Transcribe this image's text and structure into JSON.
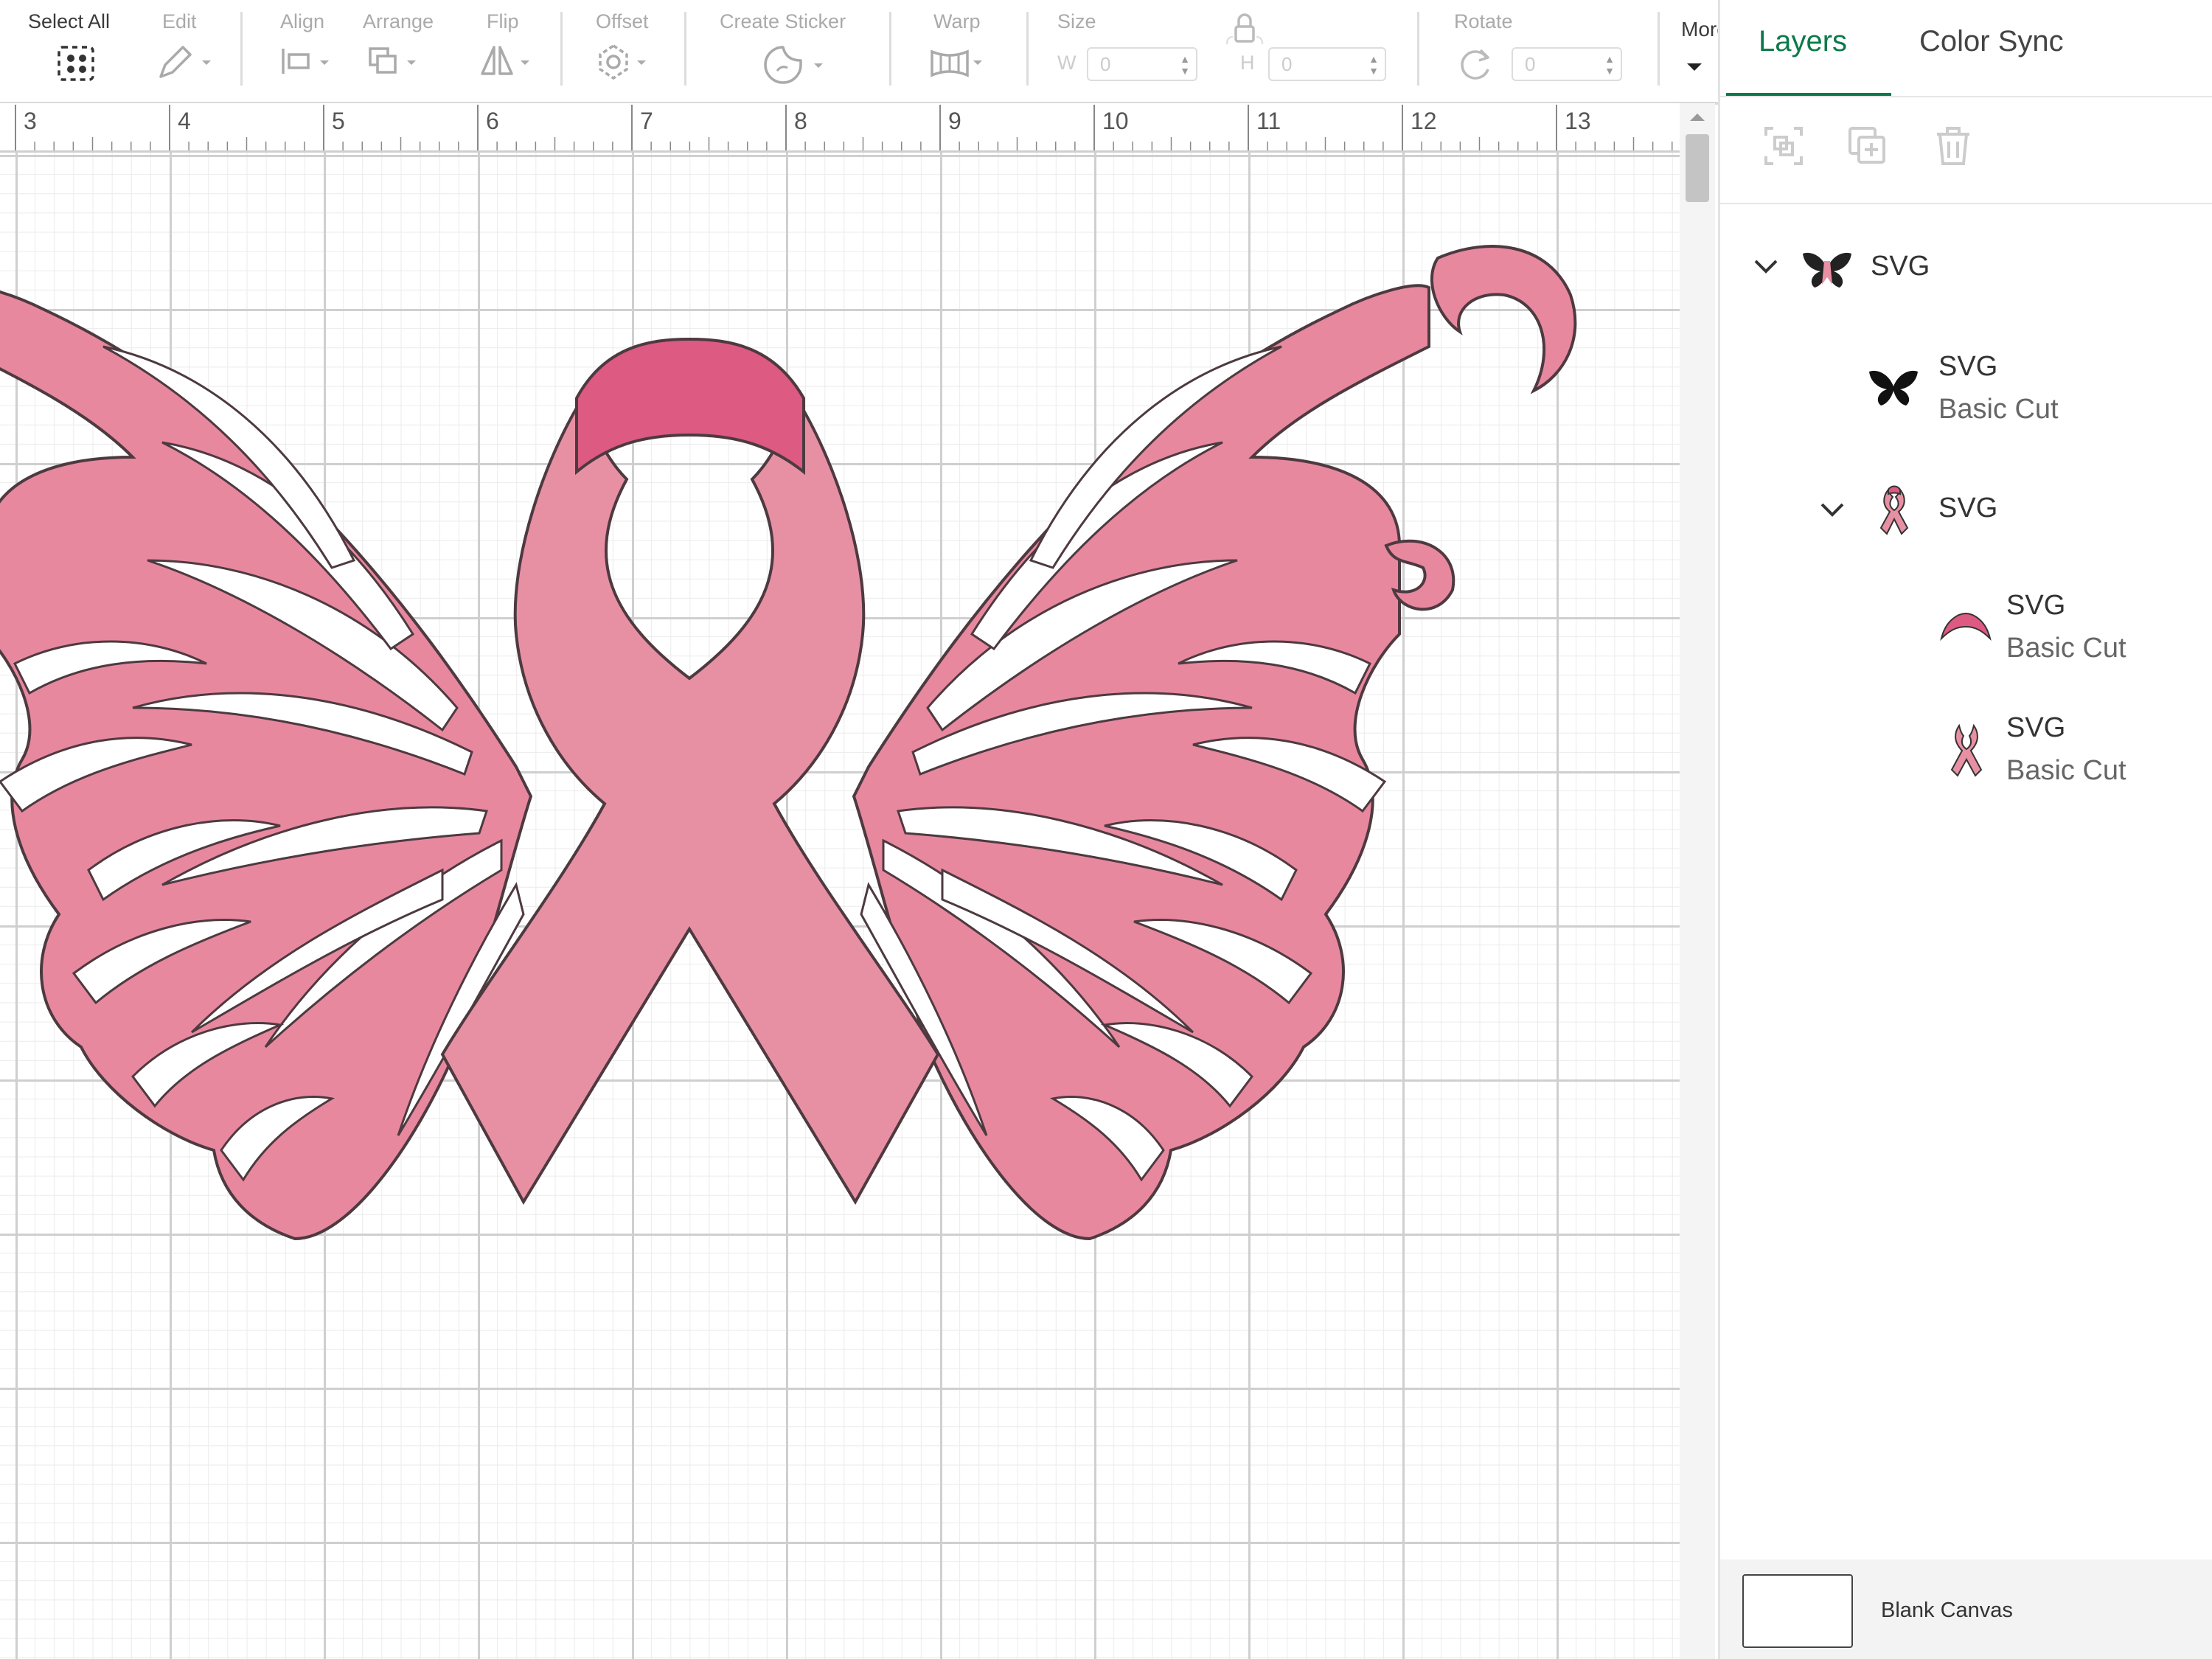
{
  "toolbar": {
    "select_all": "Select All",
    "edit": "Edit",
    "align": "Align",
    "arrange": "Arrange",
    "flip": "Flip",
    "offset": "Offset",
    "create_sticker": "Create Sticker",
    "warp": "Warp",
    "size": "Size",
    "width_label": "W",
    "width_value": "0",
    "height_label": "H",
    "height_value": "0",
    "rotate": "Rotate",
    "rotate_value": "0",
    "more": "More"
  },
  "ruler": {
    "marks": [
      "3",
      "4",
      "5",
      "6",
      "7",
      "8",
      "9",
      "10",
      "11",
      "12",
      "13"
    ]
  },
  "panel": {
    "tabs": [
      "Layers",
      "Color Sync"
    ],
    "layers": [
      {
        "name": "SVG",
        "icon": "butterfly-group-icon"
      },
      {
        "name": "SVG",
        "sub": "Basic Cut",
        "icon": "butterfly-wings-icon"
      },
      {
        "name": "SVG",
        "icon": "ribbon-group-icon"
      },
      {
        "name": "SVG",
        "sub": "Basic Cut",
        "icon": "ribbon-top-icon"
      },
      {
        "name": "SVG",
        "sub": "Basic Cut",
        "icon": "ribbon-body-icon"
      }
    ],
    "blank_canvas": "Blank Canvas"
  },
  "colors": {
    "accent": "#0b7a4b",
    "wing_pink": "#e8889f",
    "ribbon_pink": "#e890a3",
    "ribbon_top": "#dd5a82",
    "outline": "#4d3a40"
  }
}
